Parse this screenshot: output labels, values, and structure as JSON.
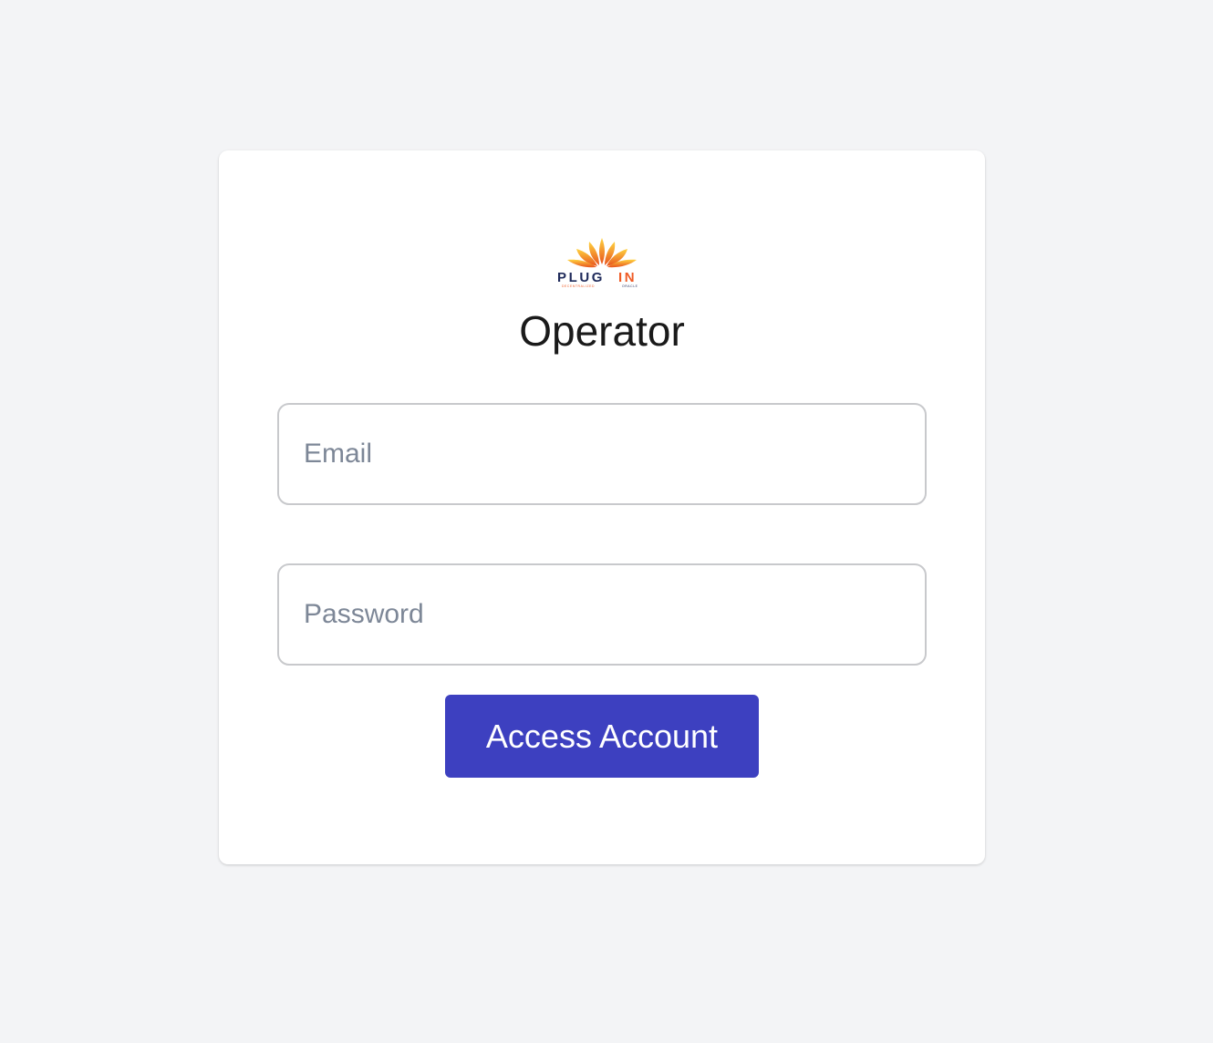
{
  "brand": {
    "logo_text": "PLUGIN",
    "logo_subtext": "DECENTRALIZED ORACLE",
    "colors": {
      "ray_light": "#ffd23f",
      "ray_dark": "#e8531d",
      "text_dark": "#1f2a5a",
      "text_accent": "#ef5b25"
    }
  },
  "page": {
    "title": "Operator"
  },
  "form": {
    "email_placeholder": "Email",
    "email_value": "",
    "password_placeholder": "Password",
    "password_value": "",
    "submit_label": "Access Account"
  },
  "theme": {
    "background": "#f3f4f6",
    "card": "#ffffff",
    "button": "#3d40c0",
    "button_text": "#ffffff",
    "input_border": "#c8c9cc",
    "placeholder": "#7d8797"
  }
}
